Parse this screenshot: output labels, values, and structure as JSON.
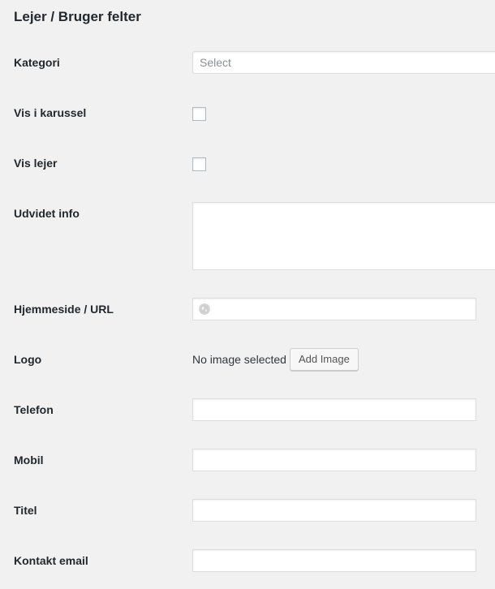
{
  "section": {
    "title": "Lejer / Bruger felter"
  },
  "fields": {
    "kategori": {
      "label": "Kategori",
      "placeholder": "Select"
    },
    "vis_karussel": {
      "label": "Vis i karussel",
      "checked": false
    },
    "vis_lejer": {
      "label": "Vis lejer",
      "checked": false
    },
    "udvidet_info": {
      "label": "Udvidet info",
      "value": ""
    },
    "hjemmeside": {
      "label": "Hjemmeside / URL",
      "value": "",
      "icon": "globe-icon"
    },
    "logo": {
      "label": "Logo",
      "status": "No image selected",
      "button_label": "Add Image"
    },
    "telefon": {
      "label": "Telefon",
      "value": ""
    },
    "mobil": {
      "label": "Mobil",
      "value": ""
    },
    "titel": {
      "label": "Titel",
      "value": ""
    },
    "kontakt_email": {
      "label": "Kontakt email",
      "value": ""
    }
  },
  "colors": {
    "background": "#f1f1f1",
    "text": "#23282d",
    "border": "#dddddd"
  }
}
